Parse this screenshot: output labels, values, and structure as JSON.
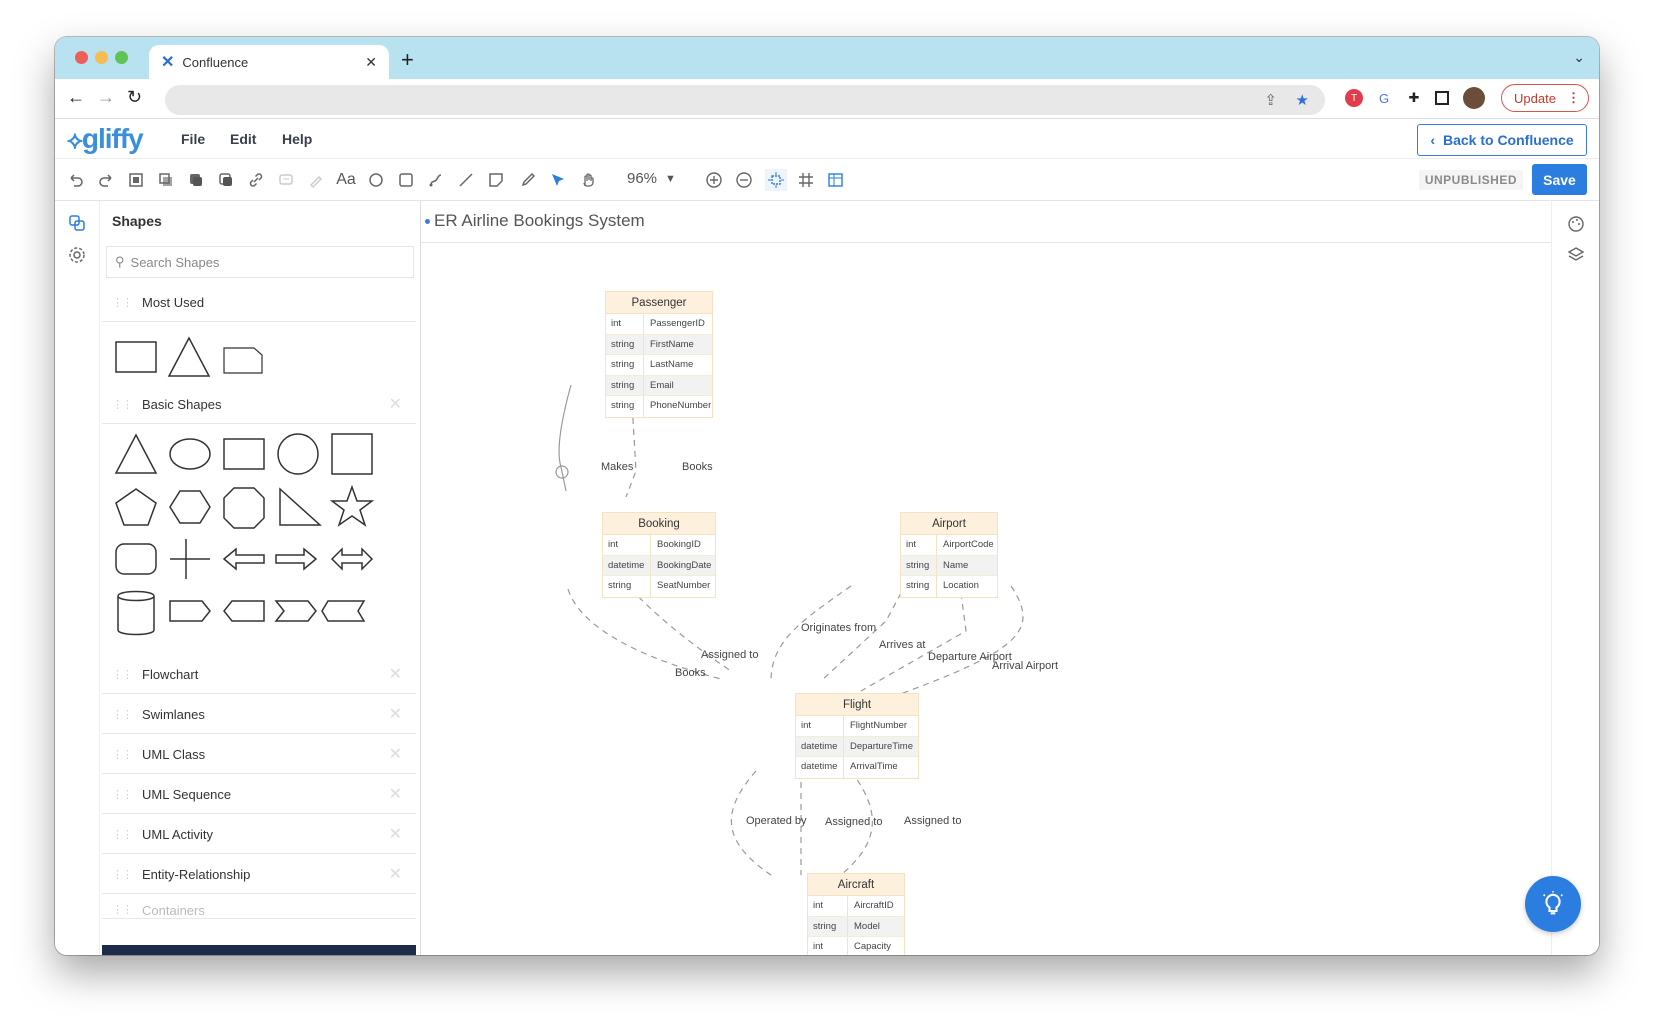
{
  "browser": {
    "tab_title": "Confluence",
    "tab_icon": "confluence-icon",
    "new_tab_label": "+",
    "update_label": "Update",
    "traffic_colors": [
      "#ee5f57",
      "#f5bd4f",
      "#5fc454"
    ]
  },
  "app": {
    "logo": "gliffy",
    "menu": [
      "File",
      "Edit",
      "Help"
    ],
    "back_label": "Back to Confluence",
    "status": "UNPUBLISHED",
    "save_label": "Save",
    "accent": "#2b7de0"
  },
  "toolbar": {
    "zoom": "96%",
    "tools": [
      "undo-icon",
      "redo-icon",
      "group-icon",
      "arrange-icon",
      "bring-front-icon",
      "send-back-icon",
      "link-icon",
      "comment-icon",
      "eyedropper-icon",
      "text-icon",
      "ellipse-icon",
      "rectangle-icon",
      "connector-icon",
      "line-icon",
      "note-icon",
      "pencil-icon",
      "pointer-icon",
      "hand-icon",
      "zoom-in-icon",
      "zoom-out-icon",
      "snap-icon",
      "grid-icon",
      "table-icon"
    ]
  },
  "shapes_panel": {
    "title": "Shapes",
    "search_placeholder": "Search Shapes",
    "categories": [
      {
        "label": "Most Used"
      },
      {
        "label": "Basic Shapes"
      },
      {
        "label": "Flowchart"
      },
      {
        "label": "Swimlanes"
      },
      {
        "label": "UML Class"
      },
      {
        "label": "UML Sequence"
      },
      {
        "label": "UML Activity"
      },
      {
        "label": "Entity-Relationship"
      },
      {
        "label": "Containers"
      }
    ]
  },
  "canvas": {
    "title": "ER Airline Bookings System",
    "entities": [
      {
        "name": "Passenger",
        "fields": [
          [
            "int",
            "PassengerID"
          ],
          [
            "string",
            "FirstName"
          ],
          [
            "string",
            "LastName"
          ],
          [
            "string",
            "Email"
          ],
          [
            "string",
            "PhoneNumber"
          ]
        ]
      },
      {
        "name": "Booking",
        "fields": [
          [
            "int",
            "BookingID"
          ],
          [
            "datetime",
            "BookingDate"
          ],
          [
            "string",
            "SeatNumber"
          ]
        ]
      },
      {
        "name": "Airport",
        "fields": [
          [
            "int",
            "AirportCode"
          ],
          [
            "string",
            "Name"
          ],
          [
            "string",
            "Location"
          ]
        ]
      },
      {
        "name": "Flight",
        "fields": [
          [
            "int",
            "FlightNumber"
          ],
          [
            "datetime",
            "DepartureTime"
          ],
          [
            "datetime",
            "ArrivalTime"
          ]
        ]
      },
      {
        "name": "Aircraft",
        "fields": [
          [
            "int",
            "AircraftID"
          ],
          [
            "string",
            "Model"
          ],
          [
            "int",
            "Capacity"
          ]
        ]
      }
    ],
    "relationships": [
      "Makes",
      "Books",
      "Assigned to",
      "Books",
      "Originates from",
      "Arrives at",
      "Departure Airport",
      "Arrival Airport",
      "Operated by",
      "Assigned to",
      "Assigned to"
    ]
  }
}
